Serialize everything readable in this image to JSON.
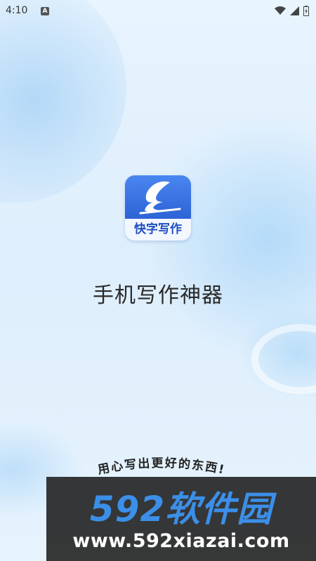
{
  "status_bar": {
    "time": "4:10",
    "notification_label": "A",
    "icons": [
      "wifi-icon",
      "signal-icon",
      "battery-icon"
    ]
  },
  "splash": {
    "app_icon_text": "快字写作",
    "slogan": "手机写作神器",
    "tagline": "用心写出更好的东西!"
  },
  "watermark": {
    "brand": "592软件园",
    "url": "www.592xiazai.com"
  },
  "colors": {
    "accent": "#2d63d6",
    "background": "#e3f1fd",
    "watermark_blue": "#3b8fe8"
  }
}
